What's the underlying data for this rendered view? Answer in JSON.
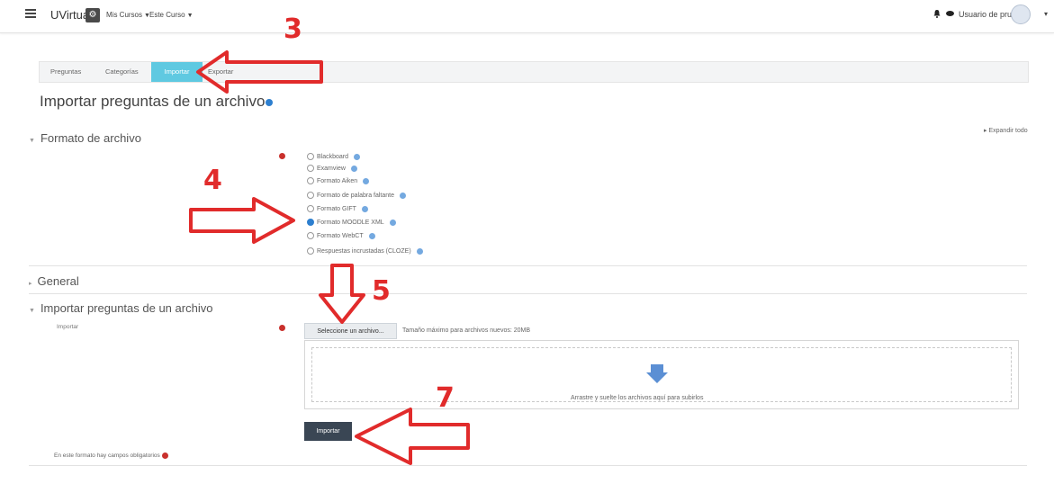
{
  "navbar": {
    "brand": "UVirtual",
    "links": [
      "Mis Cursos",
      "Este Curso"
    ],
    "user_name": "Usuario de pruebas"
  },
  "tabs": [
    {
      "label": "Preguntas",
      "active": false
    },
    {
      "label": "Categorías",
      "active": false
    },
    {
      "label": "Importar",
      "active": true
    },
    {
      "label": "Exportar",
      "active": false
    }
  ],
  "page_title": "Importar preguntas de un archivo",
  "expand_all": "Expandir todo",
  "sections": {
    "formato": "Formato de archivo",
    "general": "General",
    "importar": "Importar preguntas de un archivo"
  },
  "formats": [
    {
      "label": "Blackboard",
      "checked": false
    },
    {
      "label": "Examview",
      "checked": false
    },
    {
      "label": "Formato Aiken",
      "checked": false
    },
    {
      "label": "Formato de palabra faltante",
      "checked": false
    },
    {
      "label": "Formato GIFT",
      "checked": false
    },
    {
      "label": "Formato MOODLE XML",
      "checked": true
    },
    {
      "label": "Formato WebCT",
      "checked": false
    },
    {
      "label": "Respuestas incrustadas (CLOZE)",
      "checked": false
    }
  ],
  "file": {
    "field_label": "Importar",
    "choose_button": "Seleccione un archivo...",
    "max_size": "Tamaño máximo para archivos nuevos: 20MB",
    "drop_text": "Arrastre y suelte los archivos aquí para subirlos"
  },
  "import_button": "Importar",
  "required_note": "En este formato hay campos obligatorios",
  "annotations": [
    "3",
    "4",
    "5",
    "7"
  ],
  "colors": {
    "accent_tab": "#5fc9e1",
    "annotation_red": "#e12b2b",
    "button_dark": "#3a4654"
  }
}
